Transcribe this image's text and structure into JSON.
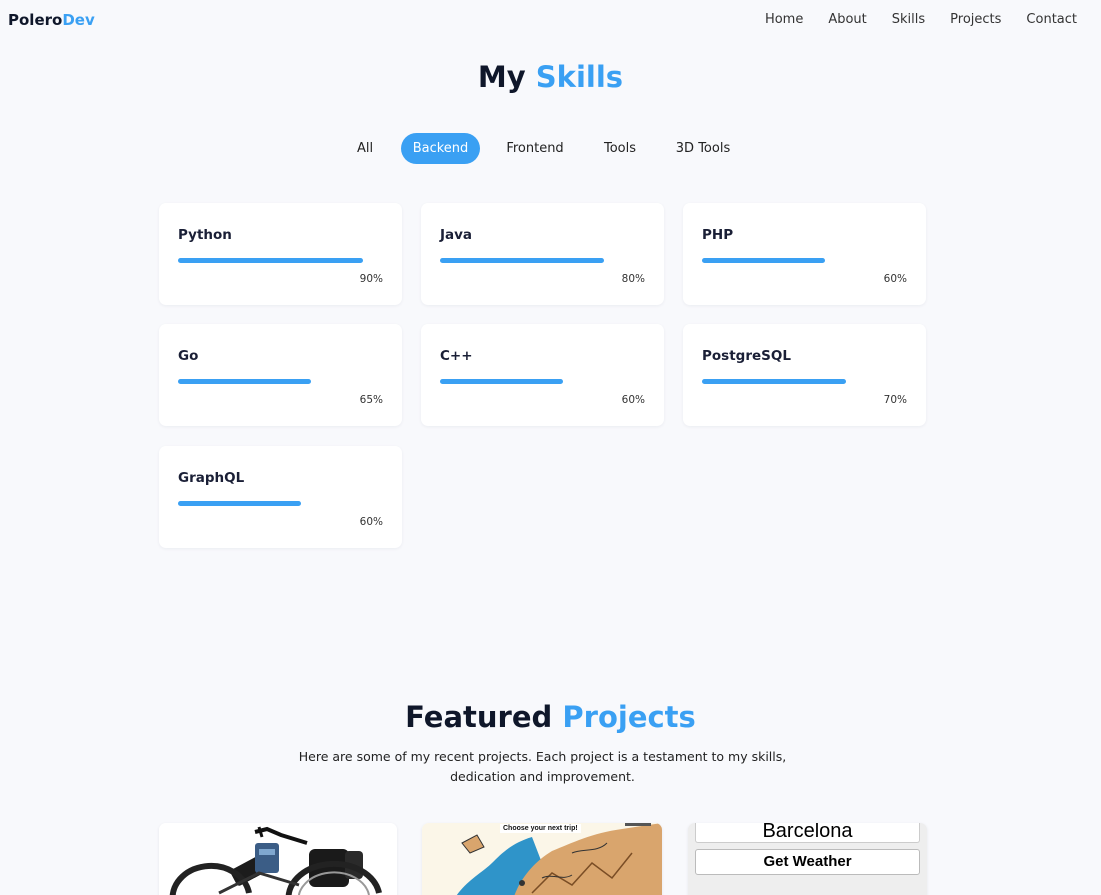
{
  "navbar": {
    "logo_main": "Polero",
    "logo_accent": "Dev",
    "links": [
      "Home",
      "About",
      "Skills",
      "Projects",
      "Contact"
    ]
  },
  "skills_section": {
    "title_main": "My",
    "title_accent": "Skills",
    "filters": [
      "All",
      "Backend",
      "Frontend",
      "Tools",
      "3D Tools"
    ],
    "active_filter": "Backend",
    "skills": [
      {
        "name": "Python",
        "percent": 90,
        "label": "90%"
      },
      {
        "name": "Java",
        "percent": 80,
        "label": "80%"
      },
      {
        "name": "PHP",
        "percent": 60,
        "label": "60%"
      },
      {
        "name": "Go",
        "percent": 65,
        "label": "65%"
      },
      {
        "name": "C++",
        "percent": 60,
        "label": "60%"
      },
      {
        "name": "PostgreSQL",
        "percent": 70,
        "label": "70%"
      },
      {
        "name": "GraphQL",
        "percent": 60,
        "label": "60%"
      }
    ]
  },
  "projects_section": {
    "title_main": "Featured",
    "title_accent": "Projects",
    "description": "Here are some of my recent projects. Each project is a testament to my skills, dedication and improvement.",
    "weather_card": {
      "city": "Barcelona",
      "button": "Get Weather"
    },
    "map_card": {
      "banner": "Choose your next trip!"
    }
  },
  "colors": {
    "accent": "#3aa0f3",
    "background": "#f8f9fc",
    "heading": "#0f172a"
  }
}
